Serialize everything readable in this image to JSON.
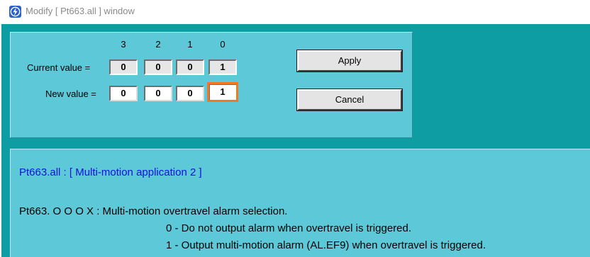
{
  "window": {
    "title": "Modify [ Pt663.all ] window",
    "icon": "app-lightning-icon"
  },
  "digits": {
    "headers": [
      "3",
      "2",
      "1",
      "0"
    ]
  },
  "current_value": {
    "label": "Current value =",
    "values": [
      "0",
      "0",
      "0",
      "1"
    ]
  },
  "new_value": {
    "label": "New value =",
    "values": [
      "0",
      "0",
      "0",
      "1"
    ],
    "focused_index": 3
  },
  "buttons": {
    "apply": "Apply",
    "cancel": "Cancel"
  },
  "description": {
    "heading": "Pt663.all :  [ Multi-motion application 2 ]",
    "line1": "Pt663.  O  O  O  X  : Multi-motion overtravel alarm selection.",
    "option0": "0 - Do not output alarm when overtravel is triggered.",
    "option1": "1 - Output multi-motion alarm (AL.EF9) when overtravel is triggered."
  },
  "colors": {
    "client_bg": "#0f9da4",
    "panel_bg": "#5cc8d8",
    "heading_text": "#1010e0",
    "focus_border": "#f07a24"
  }
}
